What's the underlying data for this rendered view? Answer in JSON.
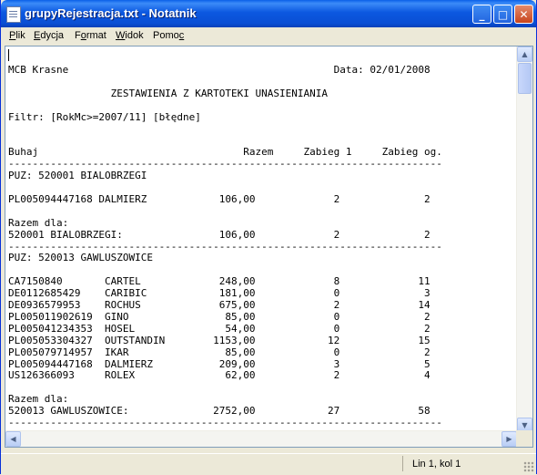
{
  "window": {
    "title": "grupyRejestracja.txt - Notatnik",
    "controls": {
      "minimize": "_",
      "maximize": "□",
      "close": "✕"
    }
  },
  "menu": [
    {
      "accel": "P",
      "rest": "lik"
    },
    {
      "accel": "E",
      "rest": "dycja"
    },
    {
      "pre": "F",
      "accel": "o",
      "rest": "rmat"
    },
    {
      "accel": "W",
      "rest": "idok"
    },
    {
      "pre": "Pomo",
      "accel": "c",
      "rest": ""
    }
  ],
  "document": {
    "lines": [
      "",
      "MCB Krasne                                            Data: 02/01/2008",
      "",
      "                 ZESTAWIENIA Z KARTOTEKI UNASIENIANIA",
      "",
      "Filtr: [RokMc>=2007/11] [błędne]",
      "",
      "",
      "Buhaj                                  Razem     Zabieg 1     Zabieg og.",
      "------------------------------------------------------------------------",
      "PUZ: 520001 BIALOBRZEGI",
      "",
      "PL005094447168 DALMIERZ            106,00             2              2",
      "",
      "Razem dla:",
      "520001 BIALOBRZEGI:                106,00             2              2",
      "------------------------------------------------------------------------",
      "PUZ: 520013 GAWLUSZOWICE",
      "",
      "CA7150840       CARTEL             248,00             8             11",
      "DE0112685429    CARIBIC            181,00             0              3",
      "DE0936579953    ROCHUS             675,00             2             14",
      "PL005011902619  GINO                85,00             0              2",
      "PL005041234353  HOSEL               54,00             0              2",
      "PL005053304327  OUTSTANDIN        1153,00            12             15",
      "PL005079714957  IKAR                85,00             0              2",
      "PL005094447168  DALMIERZ           209,00             3              5",
      "US126366093     ROLEX               62,00             2              4",
      "",
      "Razem dla:",
      "520013 GAWLUSZOWICE:              2752,00            27             58",
      "------------------------------------------------------------------------"
    ]
  },
  "status": {
    "position": "Lin 1, kol 1"
  },
  "scroll": {
    "vertical_position": 0,
    "horizontal_position": 0
  }
}
